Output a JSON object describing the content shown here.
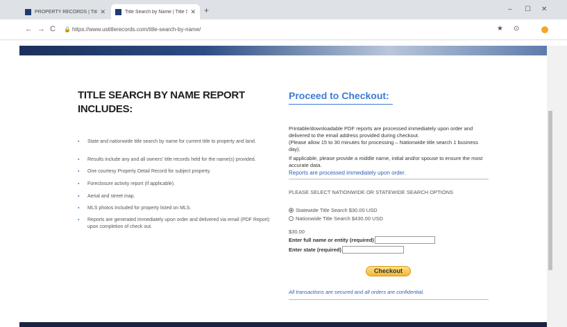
{
  "browser": {
    "tabs": [
      {
        "label": "PROPERTY RECORDS | Title Search"
      },
      {
        "label": "Title Search by Name | Title Sear"
      }
    ],
    "new_tab": "+",
    "url": "https://www.ustitlerecords.com/title-search-by-name/",
    "window_controls": {
      "minimize": "–",
      "maximize": "☐",
      "close": "✕"
    }
  },
  "left": {
    "heading": "TITLE SEARCH BY NAME REPORT INCLUDES:",
    "bullets": [
      "State and nationwide title search by name for current title to property and land.",
      "Results include any and all owners' title records held for the name(s) provided.",
      "One courtesy Property Detail Record for subject property.",
      "Foreclosure activity report (if applicable).",
      "Aerial and street map.",
      "MLS photos included for property listed on MLS.",
      "Reports are generated immediately upon order and delivered via email (PDF Report) upon completion of check out."
    ]
  },
  "right": {
    "heading": "Proceed to Checkout:",
    "para1": "Printable/downloadable PDF reports are processed immediately upon order and delivered to the email address provided during checkout.",
    "para2": "(Please allow 15 to 30 minutes for processing – Nationwide title search 1 business day).",
    "para3": "If applicable, please provide a middle name, initial and/or spouse to ensure the most accurate data.",
    "processed": "Reports are processed immediately upon order.",
    "select_label": "PLEASE SELECT NATIONWIDE OR STATEWIDE SEARCH OPTIONS",
    "options": [
      {
        "label": "Statewide Title Search $30.00 USD",
        "selected": true
      },
      {
        "label": "Nationwide Title Search $430.00 USD",
        "selected": false
      }
    ],
    "price": "$30.00",
    "name_label": "Enter full name or entity (required)",
    "name_value": "",
    "state_label": "Enter state (required)",
    "state_value": "",
    "checkout": "Checkout",
    "secure_note": "All transactions are secured and all orders are confidential."
  }
}
